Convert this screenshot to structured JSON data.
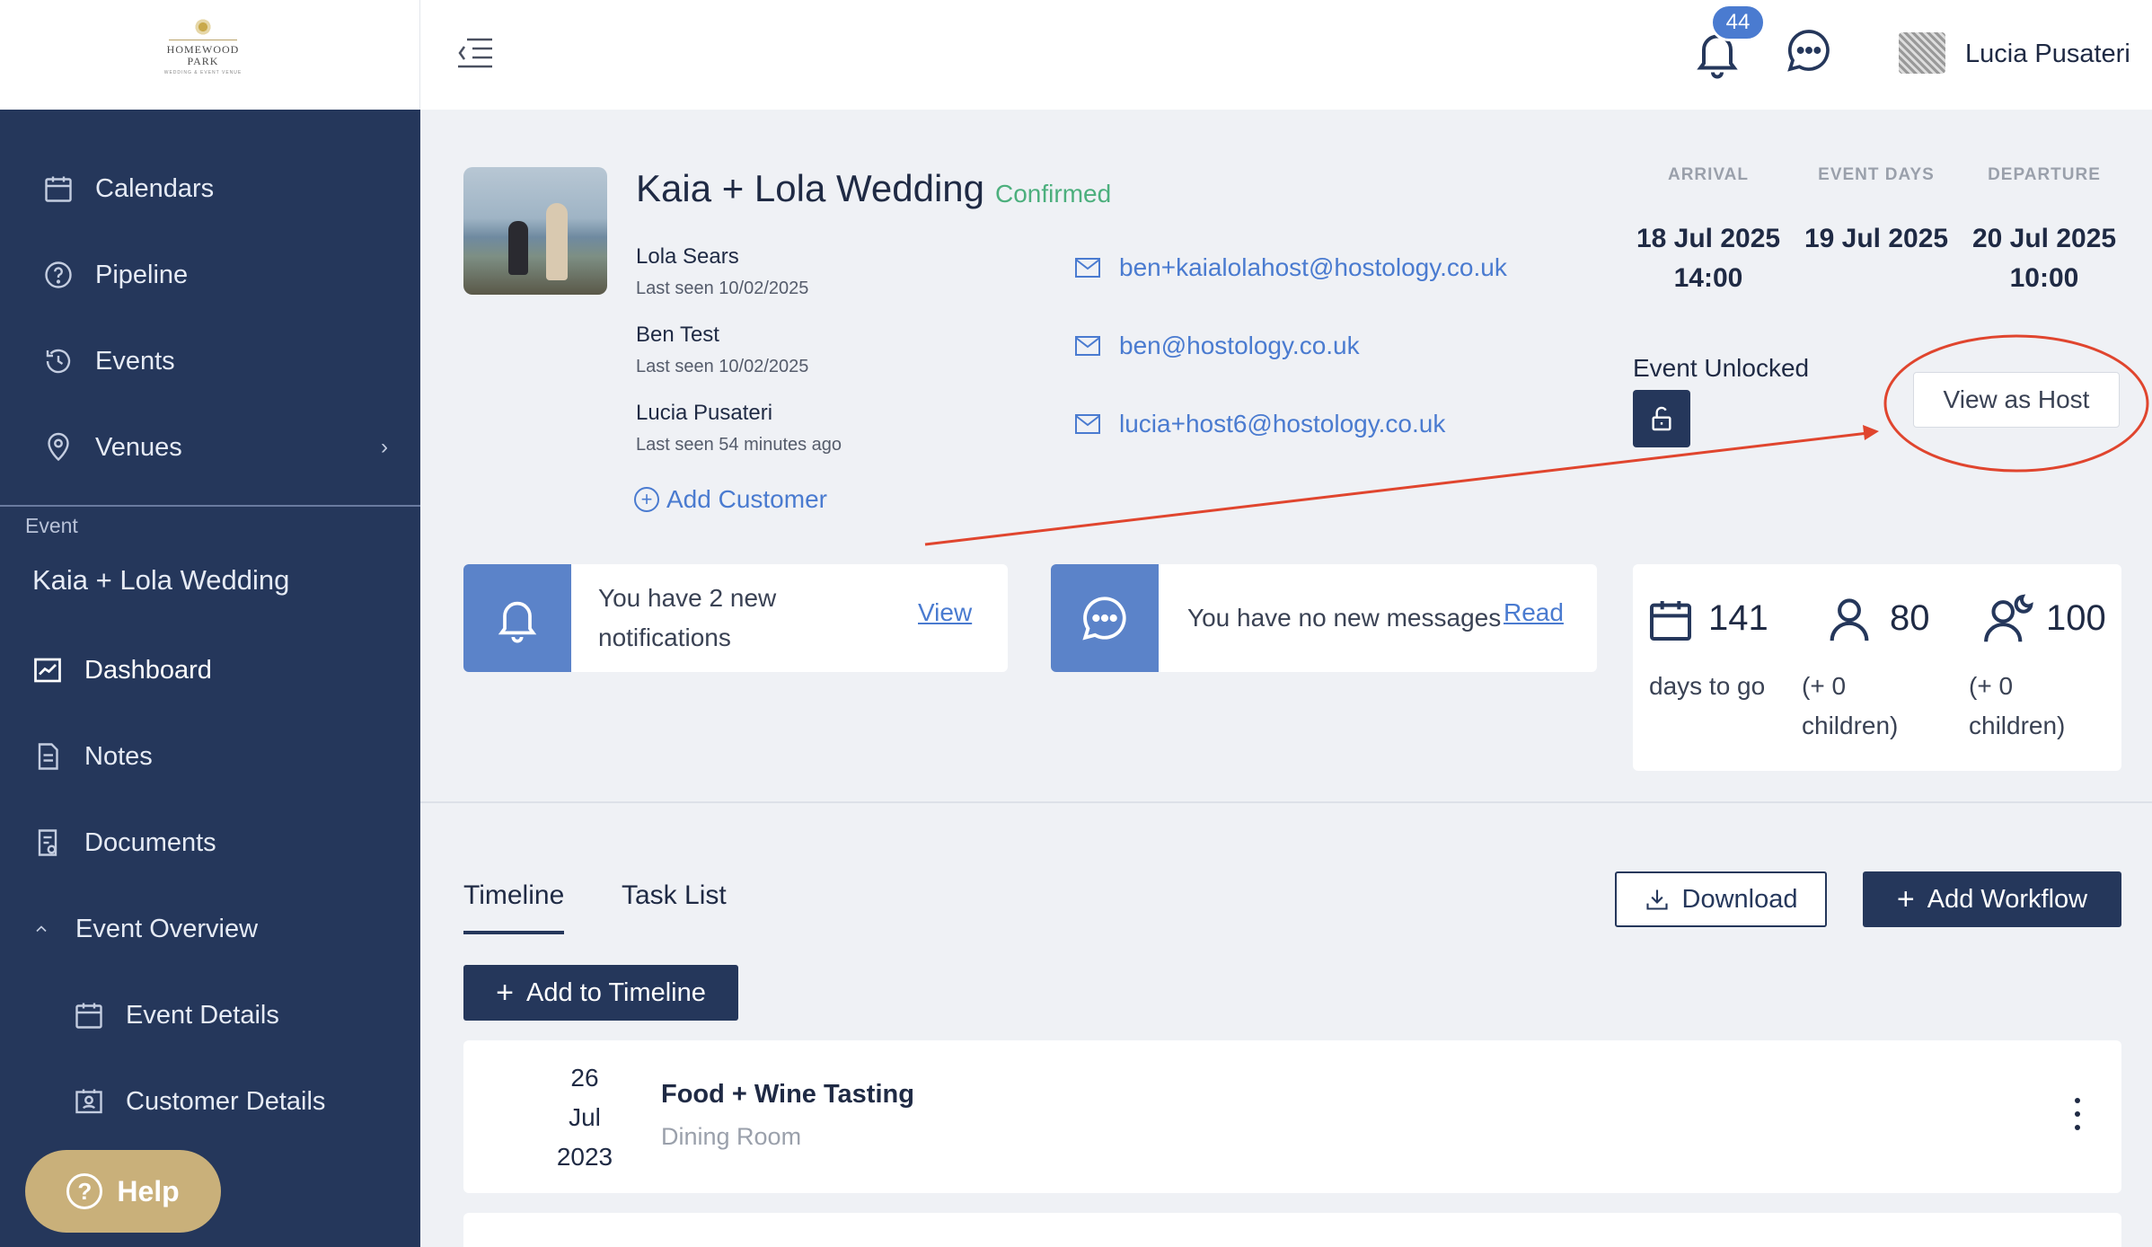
{
  "brand": {
    "logo_line1": "HOMEWOOD",
    "logo_line2": "PARK",
    "logo_sub": "WEDDING & EVENT VENUE"
  },
  "header": {
    "notification_count": "44",
    "user_name": "Lucia Pusateri"
  },
  "sidebar": {
    "items": [
      {
        "label": "Calendars",
        "icon": "calendar-icon"
      },
      {
        "label": "Pipeline",
        "icon": "question-circle-icon"
      },
      {
        "label": "Events",
        "icon": "history-icon"
      },
      {
        "label": "Venues",
        "icon": "location-pin-icon"
      }
    ],
    "section_label": "Event",
    "event_name": "Kaia + Lola Wedding",
    "event_items": [
      {
        "label": "Dashboard",
        "icon": "chart-icon"
      },
      {
        "label": "Notes",
        "icon": "note-icon"
      },
      {
        "label": "Documents",
        "icon": "document-icon"
      },
      {
        "label": "Event Overview",
        "icon": "chevron-up-icon"
      },
      {
        "label": "Event Details",
        "icon": "calendar-icon"
      },
      {
        "label": "Customer Details",
        "icon": "contact-card-icon"
      }
    ],
    "help_label": "Help"
  },
  "event": {
    "title": "Kaia + Lola Wedding",
    "status": "Confirmed",
    "customers": [
      {
        "name": "Lola Sears",
        "seen": "Last seen 10/02/2025",
        "email": "ben+kaialolahost@hostology.co.uk"
      },
      {
        "name": "Ben Test",
        "seen": "Last seen 10/02/2025",
        "email": "ben@hostology.co.uk"
      },
      {
        "name": "Lucia Pusateri",
        "seen": "Last seen 54 minutes ago",
        "email": "lucia+host6@hostology.co.uk"
      }
    ],
    "add_customer_label": "Add Customer",
    "dates": {
      "arrival_head": "ARRIVAL",
      "arrival_date": "18 Jul 2025",
      "arrival_time": "14:00",
      "days_head": "EVENT DAYS",
      "days_date": "19 Jul 2025",
      "departure_head": "DEPARTURE",
      "departure_date": "20 Jul 2025",
      "departure_time": "10:00"
    },
    "unlocked_label": "Event Unlocked",
    "view_as_host_label": "View as Host"
  },
  "cards": {
    "notifications_line1": "You have 2 new",
    "notifications_line2": "notifications",
    "notifications_link": "View",
    "messages_text": "You have no new messages",
    "messages_link": "Read"
  },
  "stats": {
    "days_value": "141",
    "days_label": "days to go",
    "guests_value": "80",
    "guests_label_1": "(+ 0",
    "guests_label_2": "children)",
    "night_value": "100",
    "night_label_1": "(+ 0",
    "night_label_2": "children)"
  },
  "tabs": {
    "timeline": "Timeline",
    "tasks": "Task List"
  },
  "actions": {
    "download": "Download",
    "add_workflow": "Add Workflow",
    "add_timeline": "Add to Timeline"
  },
  "timeline": [
    {
      "day": "26",
      "month": "Jul",
      "year": "2023",
      "title": "Food + Wine Tasting",
      "location": "Dining Room"
    }
  ],
  "colors": {
    "sidebar": "#25375b",
    "accent": "#4a7bd0",
    "confirmed": "#4caf7d",
    "help": "#c9b07a",
    "annotation": "#e0452e"
  }
}
